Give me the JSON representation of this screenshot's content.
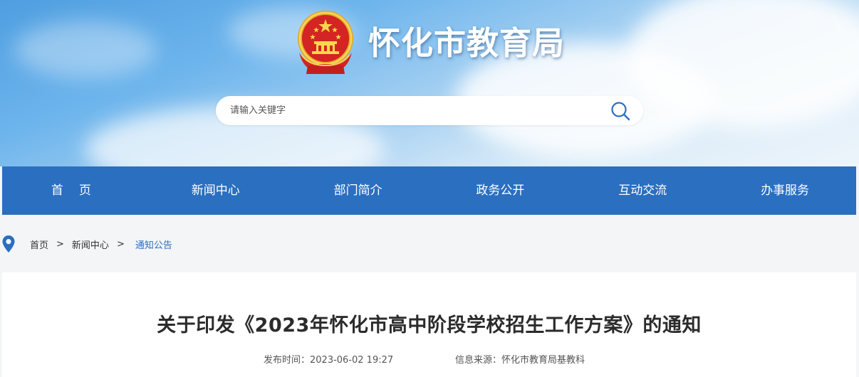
{
  "header": {
    "site_title": "怀化市教育局",
    "emblem": "national-emblem",
    "search": {
      "placeholder": "请输入关键字",
      "icon": "search-icon"
    }
  },
  "nav": {
    "items": [
      {
        "label": "首页"
      },
      {
        "label": "新闻中心"
      },
      {
        "label": "部门简介"
      },
      {
        "label": "政务公开"
      },
      {
        "label": "互动交流"
      },
      {
        "label": "办事服务"
      }
    ]
  },
  "breadcrumb": {
    "icon": "location-pin-icon",
    "items": [
      {
        "label": "首页"
      },
      {
        "label": "新闻中心"
      }
    ],
    "separator": ">",
    "current": "通知公告"
  },
  "article": {
    "title": "关于印发《2023年怀化市高中阶段学校招生工作方案》的通知",
    "publish_time": "发布时间：2023-06-02 19:27",
    "source": "信息来源：怀化市教育局基教科"
  },
  "colors": {
    "nav_blue": "#2a6fc0",
    "accent_text": "#2a6fc0",
    "banner_sky": "#6cb4ec"
  }
}
